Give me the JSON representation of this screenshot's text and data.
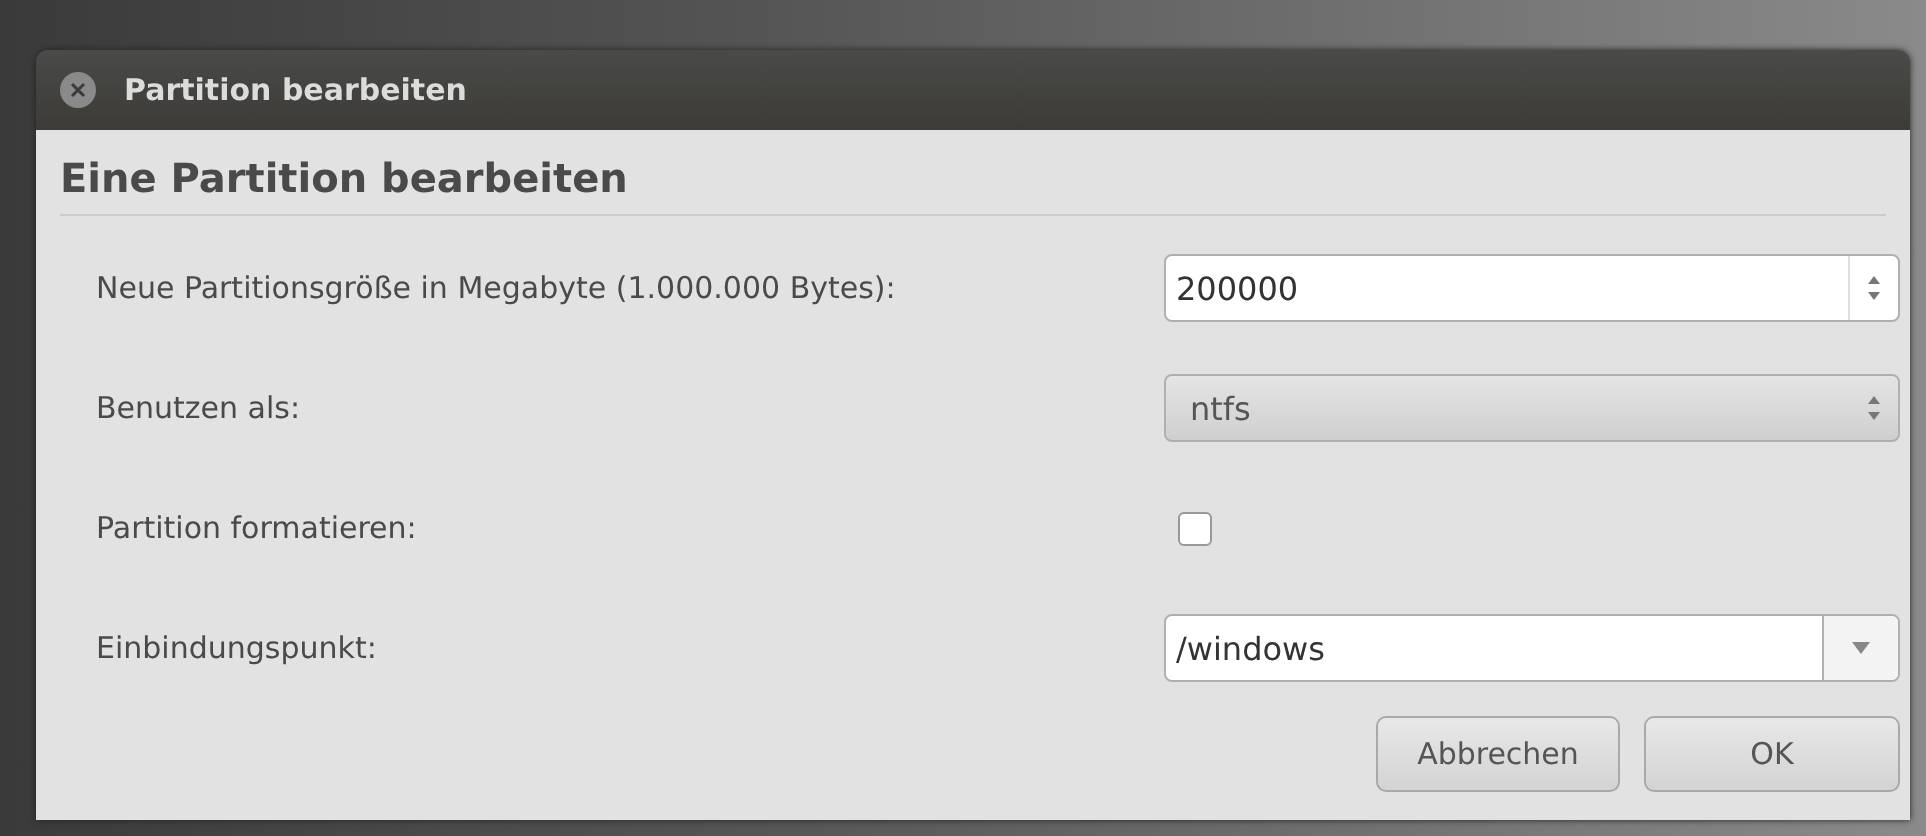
{
  "window": {
    "title": "Partition bearbeiten"
  },
  "heading": "Eine Partition bearbeiten",
  "rows": [
    {
      "kind": "spin",
      "label": "Neue Partitionsgröße in Megabyte (1.000.000 Bytes):",
      "value": "200000"
    },
    {
      "kind": "combo",
      "label": "Benutzen als:",
      "value": "ntfs"
    },
    {
      "kind": "checkbox",
      "label": "Partition formatieren:",
      "checked": false
    },
    {
      "kind": "entry-combo",
      "label": "Einbindungspunkt:",
      "value": "/windows"
    }
  ],
  "buttons": [
    "Abbrechen",
    "OK"
  ]
}
